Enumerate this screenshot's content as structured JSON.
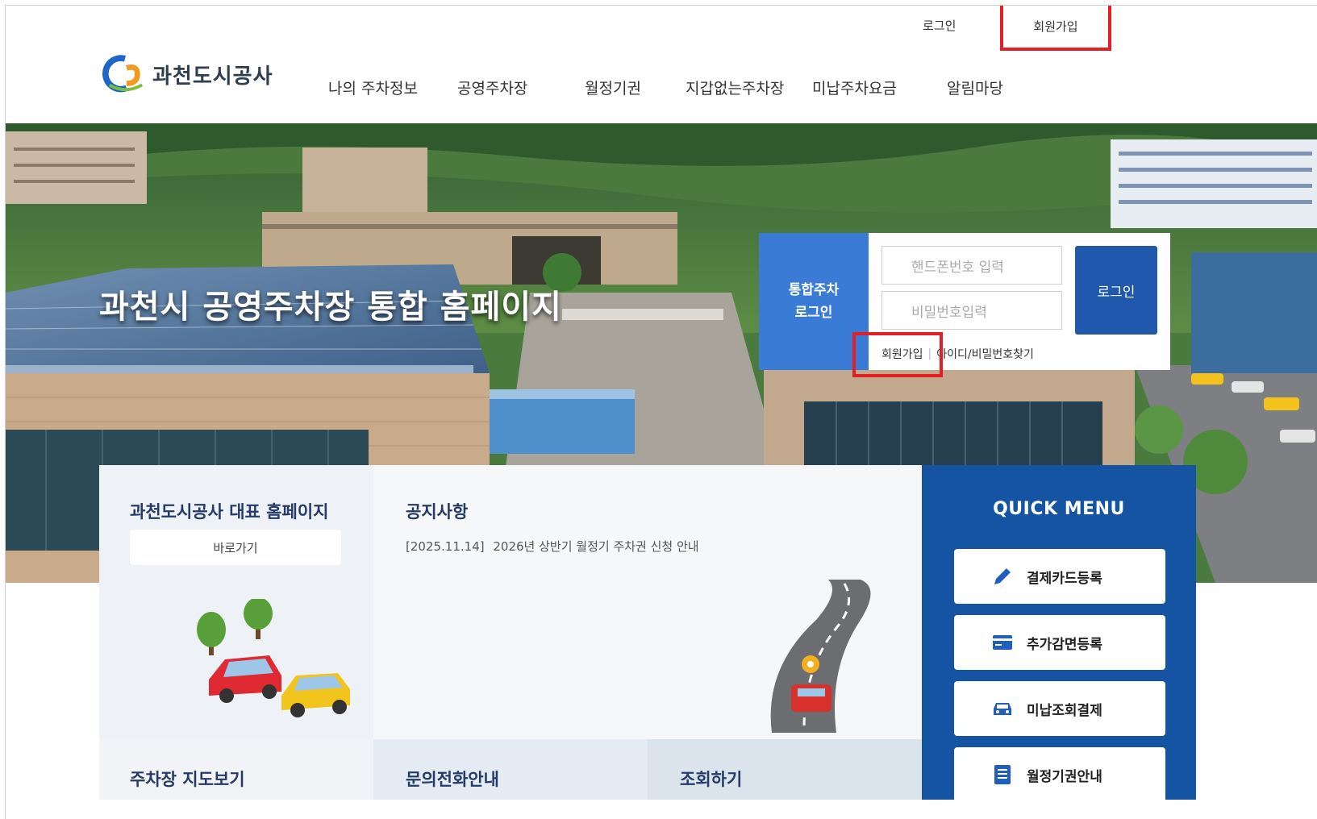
{
  "header": {
    "login_label": "로그인",
    "join_label": "회원가입",
    "logo_text": "과천도시공사",
    "nav": [
      "나의 주차정보",
      "공영주차장",
      "월정기권",
      "지갑없는주차장",
      "미납주차요금",
      "알림마당"
    ]
  },
  "hero": {
    "title": "과천시 공영주차장 통합 홈페이지"
  },
  "login_box": {
    "label_line1": "통합주차",
    "label_line2": "로그인",
    "phone_placeholder": "핸드폰번호 입력",
    "password_placeholder": "비밀번호입력",
    "login_button": "로그인",
    "join_link": "회원가입",
    "find_link": "아이디/비밀번호찾기"
  },
  "panels": {
    "homepage_title": "과천도시공사 대표 홈페이지",
    "homepage_button": "바로가기",
    "notice_title": "공지사항",
    "notice_date": "[2025.11.14]",
    "notice_text": "2026년 상반기 월정기 주차권 신청 안내",
    "map_title": "주차장 지도보기",
    "phone_title": "문의전화안내",
    "lookup_title": "조회하기"
  },
  "quick_menu": {
    "title": "QUICK MENU",
    "items": [
      {
        "label": "결제카드등록",
        "icon": "pencil-icon"
      },
      {
        "label": "추가감면등록",
        "icon": "card-icon"
      },
      {
        "label": "미납조회결제",
        "icon": "car-icon"
      },
      {
        "label": "월정기권안내",
        "icon": "document-icon"
      }
    ]
  },
  "colors": {
    "primary_blue": "#1554a3",
    "login_label_blue": "#3a7bd5",
    "highlight_red": "#e41e26"
  }
}
